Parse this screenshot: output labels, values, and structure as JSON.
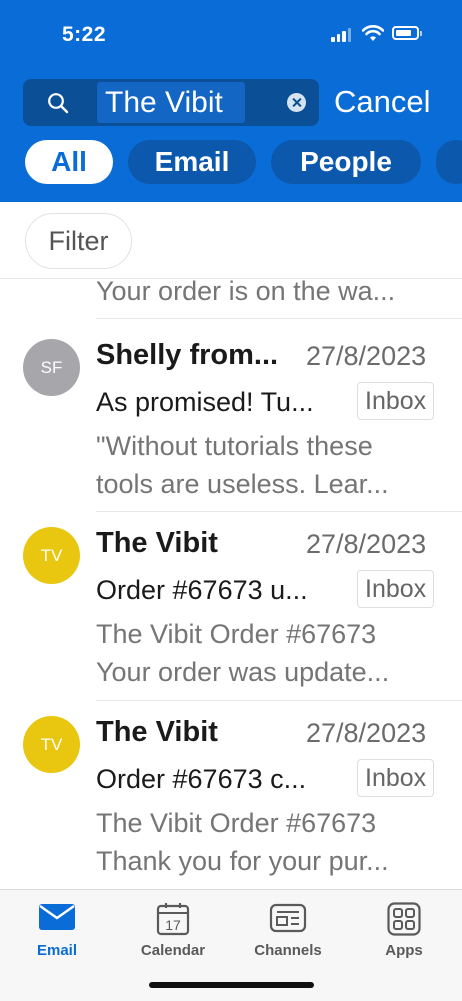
{
  "status_bar": {
    "time": "5:22"
  },
  "search": {
    "query": "The Vibit",
    "cancel_label": "Cancel"
  },
  "filter_tabs": [
    {
      "label": "All",
      "active": true
    },
    {
      "label": "Email",
      "active": false
    },
    {
      "label": "People",
      "active": false
    }
  ],
  "filter_button": {
    "label": "Filter"
  },
  "partial_preview": "Your order is on the wa...",
  "emails": [
    {
      "initials": "SF",
      "avatar_color": "#a7a7ab",
      "sender": "Shelly from...",
      "date": "27/8/2023",
      "subject": "As promised! Tu...",
      "folder": "Inbox",
      "preview_lines": [
        "\"Without tutorials these",
        "tools are useless. Lear..."
      ]
    },
    {
      "initials": "TV",
      "avatar_color": "#e9c60f",
      "sender": "The Vibit",
      "date": "27/8/2023",
      "subject": "Order #67673 u...",
      "folder": "Inbox",
      "preview_lines": [
        "The Vibit Order #67673",
        "Your order was update..."
      ]
    },
    {
      "initials": "TV",
      "avatar_color": "#e9c60f",
      "sender": "The Vibit",
      "date": "27/8/2023",
      "subject": "Order #67673 c...",
      "folder": "Inbox",
      "preview_lines": [
        "The Vibit Order #67673",
        "Thank you for your pur..."
      ]
    }
  ],
  "tab_bar": [
    {
      "label": "Email",
      "icon": "mail-icon",
      "active": true
    },
    {
      "label": "Calendar",
      "icon": "calendar-icon",
      "active": false,
      "day": "17"
    },
    {
      "label": "Channels",
      "icon": "channels-icon",
      "active": false
    },
    {
      "label": "Apps",
      "icon": "apps-grid-icon",
      "active": false
    }
  ],
  "colors": {
    "accent": "#0a6cd6",
    "header": "#0a6cd6"
  }
}
